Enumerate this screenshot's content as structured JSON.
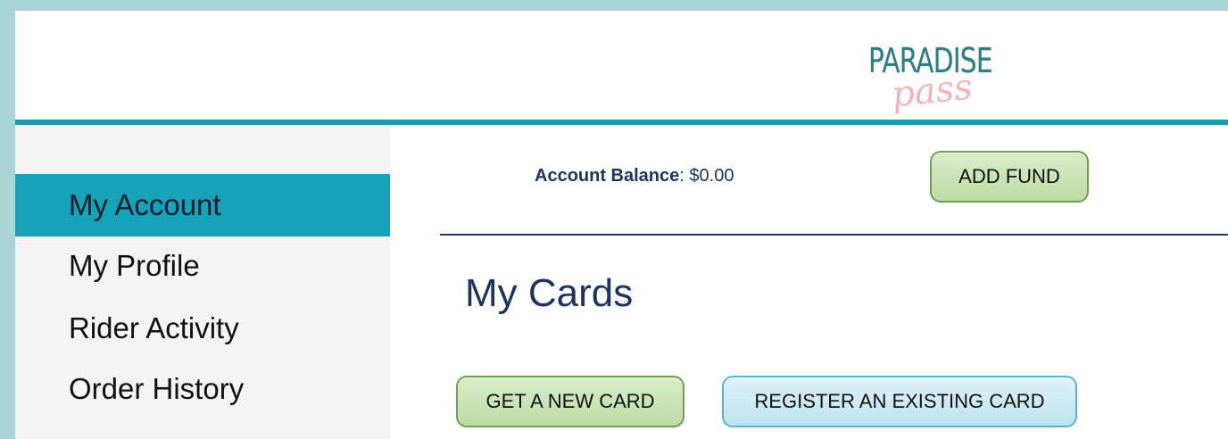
{
  "logo": {
    "main": "PARADISE",
    "script": "pass"
  },
  "sidebar": {
    "items": [
      {
        "label": "My Account",
        "active": true
      },
      {
        "label": "My Profile",
        "active": false
      },
      {
        "label": "Rider Activity",
        "active": false
      },
      {
        "label": "Order History",
        "active": false
      }
    ]
  },
  "account": {
    "balance_label": "Account Balance",
    "balance_sep": ":",
    "balance_value": "$0.00",
    "add_fund_label": "ADD FUND"
  },
  "cards": {
    "title": "My Cards",
    "get_new_label": "GET A NEW CARD",
    "register_label": "REGISTER AN EXISTING CARD"
  },
  "colors": {
    "accent_teal": "#1e9bb0",
    "active_item": "#16a2b8",
    "navy_text": "#1b3460",
    "green_button": "#bedba4",
    "blue_button": "#bde3ef",
    "page_background": "#a9d6d4"
  }
}
